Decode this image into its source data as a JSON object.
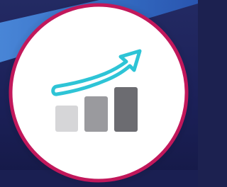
{
  "icon": {
    "name": "growth-chart-icon",
    "bar_levels": [
      0.35,
      0.5,
      0.65
    ]
  },
  "colors": {
    "background": "#1c2150",
    "background_band": "#3a7bd5",
    "circle_fill": "#ffffff",
    "circle_ring": "#c2185b",
    "arrow_fill": "#ffffff",
    "arrow_outline": "#2ec4d6",
    "bar_light": "#d6d6d8",
    "bar_mid": "#9a9a9e",
    "bar_dark": "#6c6c71"
  }
}
